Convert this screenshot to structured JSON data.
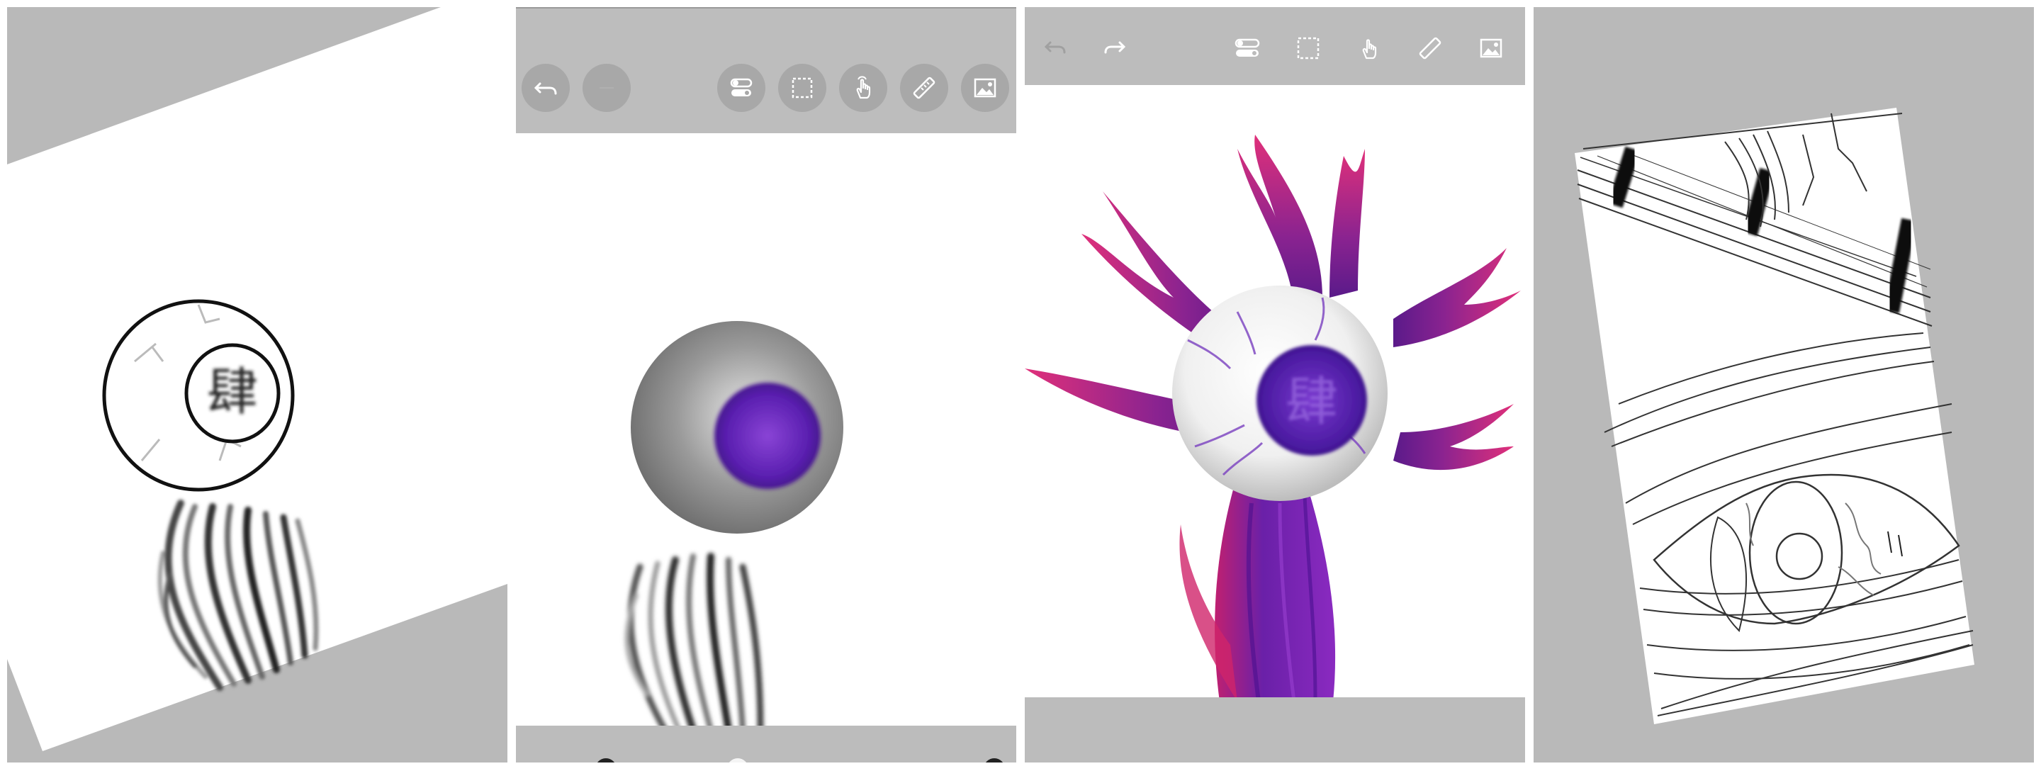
{
  "panels": [
    {
      "id": "panel-1",
      "kanji": "肆",
      "background_color": "#b9b9b9"
    },
    {
      "id": "panel-2",
      "kanji": "",
      "toolbar_buttons": [
        {
          "name": "undo-button",
          "icon": "undo-icon"
        },
        {
          "name": "redo-button",
          "icon": "redo-icon"
        },
        {
          "name": "layers-toggle-button",
          "icon": "toggle-icon"
        },
        {
          "name": "selection-button",
          "icon": "selection-icon"
        },
        {
          "name": "hand-tool-button",
          "icon": "hand-icon"
        },
        {
          "name": "ruler-button",
          "icon": "ruler-icon"
        },
        {
          "name": "image-button",
          "icon": "image-icon"
        }
      ],
      "toolbar_color": "#bdbdbd",
      "button_color": "#a8a8a8"
    },
    {
      "id": "panel-3",
      "kanji": "肆",
      "toolbar_buttons": [
        {
          "name": "undo-button",
          "icon": "undo-icon"
        },
        {
          "name": "redo-button",
          "icon": "redo-icon"
        },
        {
          "name": "layers-toggle-button",
          "icon": "toggle-icon"
        },
        {
          "name": "selection-button",
          "icon": "selection-icon"
        },
        {
          "name": "hand-tool-button",
          "icon": "hand-icon"
        },
        {
          "name": "ruler-button",
          "icon": "ruler-icon"
        },
        {
          "name": "image-button",
          "icon": "image-icon"
        }
      ],
      "accent_colors": {
        "purple": "#6a2fb0",
        "magenta": "#d0246a"
      }
    },
    {
      "id": "panel-4",
      "kanji": ""
    }
  ]
}
